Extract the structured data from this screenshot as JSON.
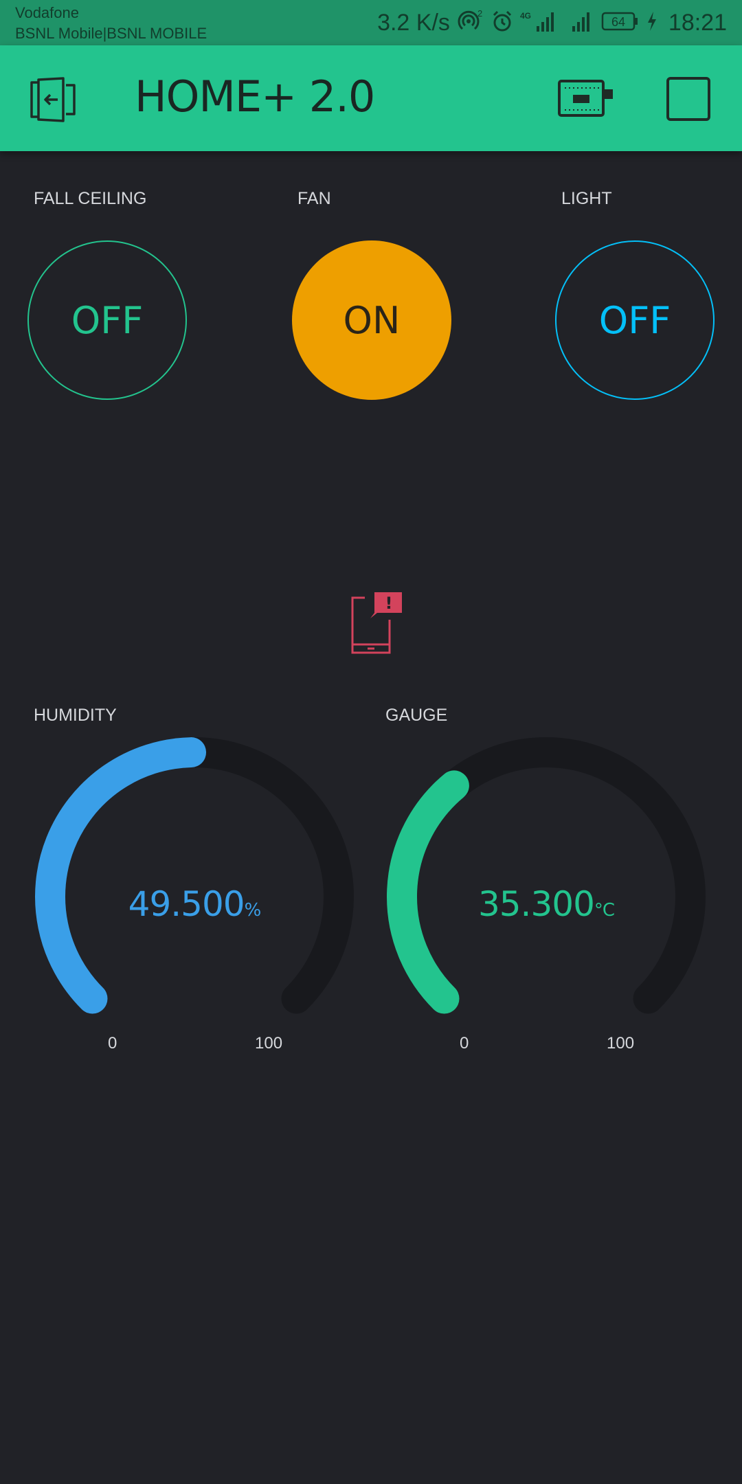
{
  "status_bar": {
    "carrier_primary": "Vodafone",
    "carrier_secondary": "BSNL Mobile|BSNL MOBILE",
    "network_speed": "3.2 K/s",
    "hotspot_count": "2",
    "network_type": "4G",
    "battery": "64",
    "time": "18:21",
    "icons": [
      "hotspot-icon",
      "alarm-icon",
      "signal-4g-icon",
      "signal-icon",
      "battery-icon",
      "charging-icon"
    ]
  },
  "app_bar": {
    "title": "HOME+ 2.0",
    "background": "#23c48e",
    "icons": [
      "exit-icon",
      "device-board-icon",
      "stop-icon"
    ]
  },
  "switches": [
    {
      "label": "FALL CEILING",
      "state": "OFF",
      "color": "#23c48e",
      "filled": false
    },
    {
      "label": "FAN",
      "state": "ON",
      "color": "#ee9f00",
      "filled": true
    },
    {
      "label": "LIGHT",
      "state": "OFF",
      "color": "#04c0f8",
      "filled": false
    }
  ],
  "notification": {
    "icon": "device-alert-icon",
    "badge": "!",
    "color": "#d3435c"
  },
  "gauges": [
    {
      "label": "HUMIDITY",
      "value": "49.500",
      "unit": "%",
      "numeric": 49.5,
      "min": "0",
      "max": "100",
      "color": "#3a9fe8"
    },
    {
      "label": "GAUGE",
      "value": "35.300",
      "unit": "°C",
      "numeric": 35.3,
      "min": "0",
      "max": "100",
      "color": "#23c48e"
    }
  ],
  "theme": {
    "background": "#212227",
    "track": "#18191d"
  }
}
